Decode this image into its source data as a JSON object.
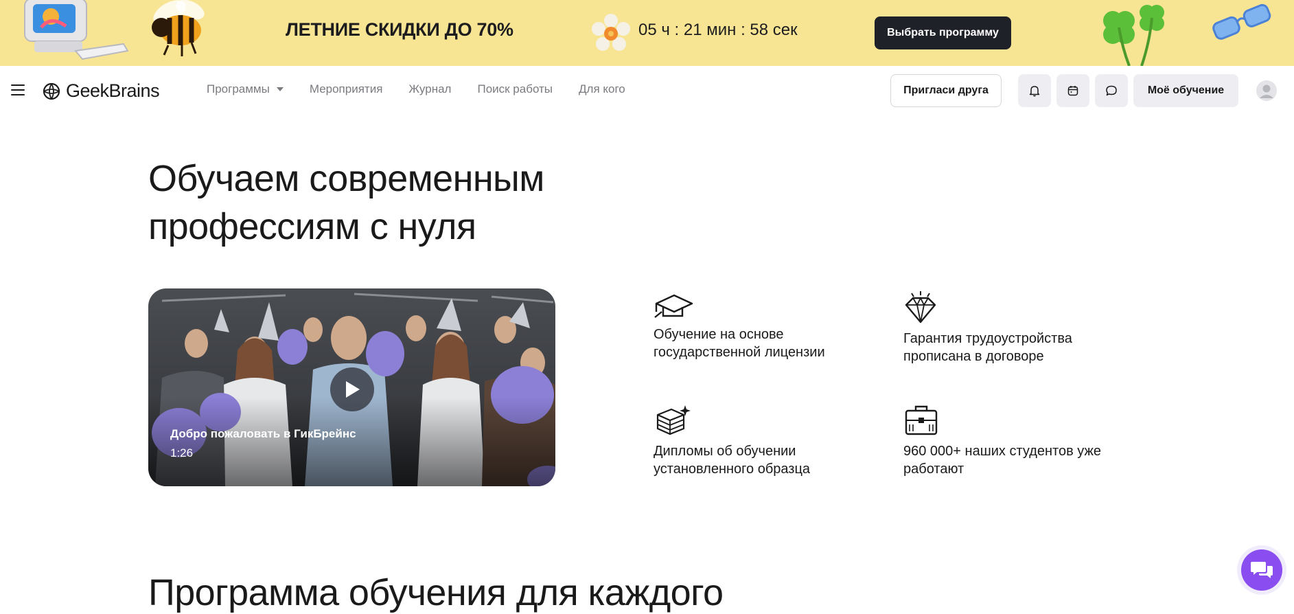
{
  "promo": {
    "title": "ЛЕТНИЕ СКИДКИ ДО 70%",
    "timer": "05 ч : 21 мин : 58 сек",
    "button_label": "Выбрать программу"
  },
  "header": {
    "logo_text": "GeekBrains",
    "nav": [
      {
        "label": "Программы",
        "has_dropdown": true
      },
      {
        "label": "Мероприятия"
      },
      {
        "label": "Журнал"
      },
      {
        "label": "Поиск работы"
      },
      {
        "label": "Для кого"
      }
    ],
    "invite_label": "Пригласи друга",
    "learning_label": "Моё обучение"
  },
  "hero": {
    "title_line1": "Обучаем современным",
    "title_line2": "профессиям с нуля",
    "video": {
      "title": "Добро пожаловать в ГикБрейнс",
      "duration": "1:26"
    },
    "features": [
      {
        "icon": "graduation-cap-icon",
        "line1": "Обучение на основе",
        "line2": "государственной лицензии"
      },
      {
        "icon": "diamond-icon",
        "line1": "Гарантия трудоустройства",
        "line2": "прописана в договоре"
      },
      {
        "icon": "diploma-stack-icon",
        "line1": "Дипломы об обучении",
        "line2": "установленного образца"
      },
      {
        "icon": "briefcase-icon",
        "line1": "960 000+ наших студентов уже",
        "line2": "работают"
      }
    ]
  },
  "section": {
    "title": "Программа обучения для каждого"
  },
  "colors": {
    "banner": "#f8e594",
    "dark_button": "#1f2128",
    "nav_text": "#7a7a80",
    "chat_accent": "#8a4ef0"
  }
}
